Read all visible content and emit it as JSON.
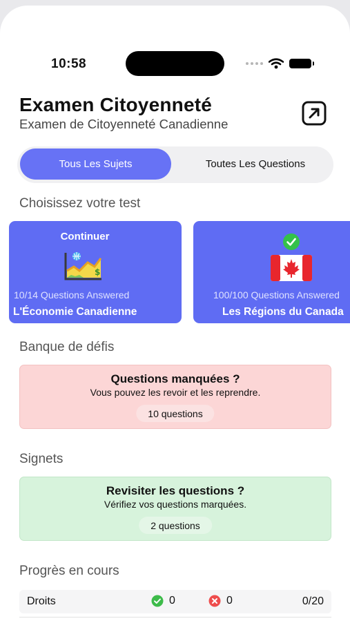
{
  "status_bar": {
    "time": "10:58"
  },
  "header": {
    "title": "Examen Citoyenneté",
    "subtitle": "Examen de Citoyenneté Canadienne"
  },
  "segments": {
    "active": "Tous Les Sujets",
    "other": "Toutes Les Questions"
  },
  "tests": {
    "label": "Choisissez votre test",
    "cards": [
      {
        "top_label": "Continuer",
        "icon": "growth-chart-icon",
        "progress": "10/14 Questions Answered",
        "name": "L'Économie Canadienne"
      },
      {
        "top_label": "",
        "icon": "canada-flag-icon",
        "progress": "100/100 Questions Answered",
        "name": "Les Régions du Canada"
      }
    ]
  },
  "challenge_bank": {
    "label": "Banque de défis",
    "title": "Questions manquées ?",
    "subtitle": "Vous pouvez les revoir et les reprendre.",
    "count": "10 questions"
  },
  "bookmarks": {
    "label": "Signets",
    "title": "Revisiter les questions ?",
    "subtitle": "Vérifiez vos questions marquées.",
    "count": "2 questions"
  },
  "progress": {
    "label": "Progrès en cours",
    "rows": [
      {
        "name": "Droits",
        "correct": "0",
        "wrong": "0",
        "total": "0/20"
      }
    ]
  },
  "colors": {
    "accent": "#6772f5",
    "card": "#5f6cf3",
    "red_box": "#fcd6d6",
    "green_box": "#d7f3dc",
    "check_green": "#3dbb4a",
    "cross_red": "#ee4d4d"
  }
}
